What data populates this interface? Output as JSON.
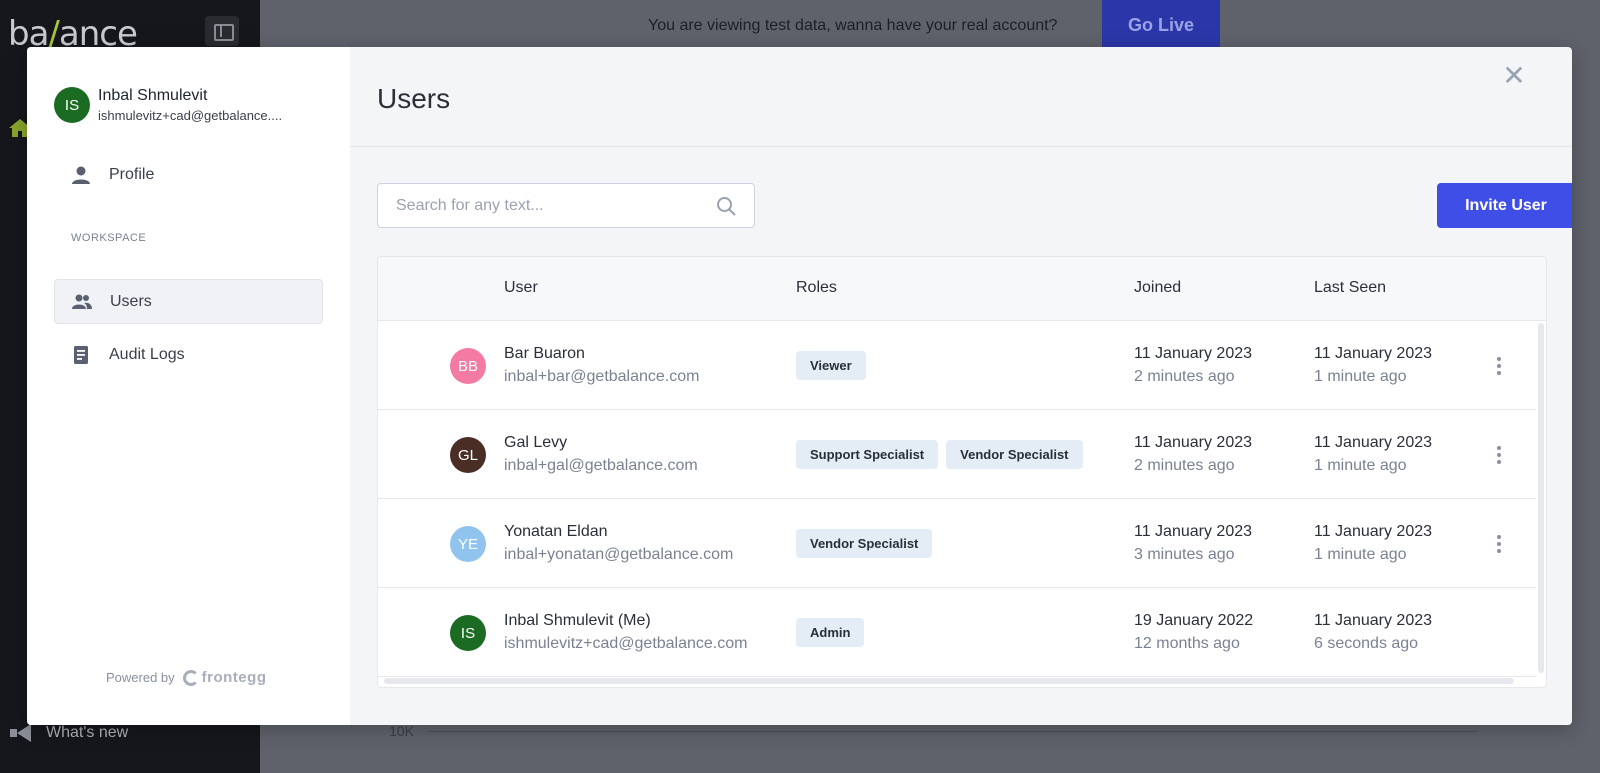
{
  "app": {
    "logo_left": "ba",
    "logo_slash": "/",
    "logo_right": "ance",
    "whats_new": "What's new",
    "banner_text": "You are viewing test data, wanna have your real account?",
    "golive_label": "Go Live",
    "chart_axis_label": "10K"
  },
  "modal": {
    "current_user": {
      "initials": "IS",
      "name": "Inbal Shmulevit",
      "email": "ishmulevitz+cad@getbalance...."
    },
    "nav": {
      "profile": "Profile",
      "section_label": "WORKSPACE",
      "users": "Users",
      "audit_logs": "Audit Logs"
    },
    "powered_by": "Powered by",
    "powered_brand": "frontegg",
    "title": "Users",
    "close_glyph": "✕",
    "search_placeholder": "Search for any text...",
    "invite_label": "Invite User",
    "columns": {
      "user": "User",
      "roles": "Roles",
      "joined": "Joined",
      "last_seen": "Last Seen"
    },
    "rows": [
      {
        "initials": "BB",
        "avatar_color": "#f27aa3",
        "name": "Bar Buaron",
        "email": "inbal+bar@getbalance.com",
        "roles": [
          "Viewer"
        ],
        "joined": "11 January 2023",
        "joined_ago": "2 minutes ago",
        "last_seen": "11 January 2023",
        "last_seen_ago": "1 minute ago"
      },
      {
        "initials": "GL",
        "avatar_color": "#4a2e26",
        "name": "Gal Levy",
        "email": "inbal+gal@getbalance.com",
        "roles": [
          "Support Specialist",
          "Vendor Specialist"
        ],
        "joined": "11 January 2023",
        "joined_ago": "2 minutes ago",
        "last_seen": "11 January 2023",
        "last_seen_ago": "1 minute ago"
      },
      {
        "initials": "YE",
        "avatar_color": "#90c4ee",
        "name": "Yonatan Eldan",
        "email": "inbal+yonatan@getbalance.com",
        "roles": [
          "Vendor Specialist"
        ],
        "joined": "11 January 2023",
        "joined_ago": "3 minutes ago",
        "last_seen": "11 January 2023",
        "last_seen_ago": "1 minute ago"
      },
      {
        "initials": "IS",
        "avatar_color": "#1b6b22",
        "name": "Inbal Shmulevit (Me)",
        "email": "ishmulevitz+cad@getbalance.com",
        "roles": [
          "Admin"
        ],
        "joined": "19 January 2022",
        "joined_ago": "12 months ago",
        "last_seen": "11 January 2023",
        "last_seen_ago": "6 seconds ago"
      }
    ],
    "colors": {
      "primary": "#3f4ee6",
      "badge_bg": "#e4ecf6"
    }
  }
}
